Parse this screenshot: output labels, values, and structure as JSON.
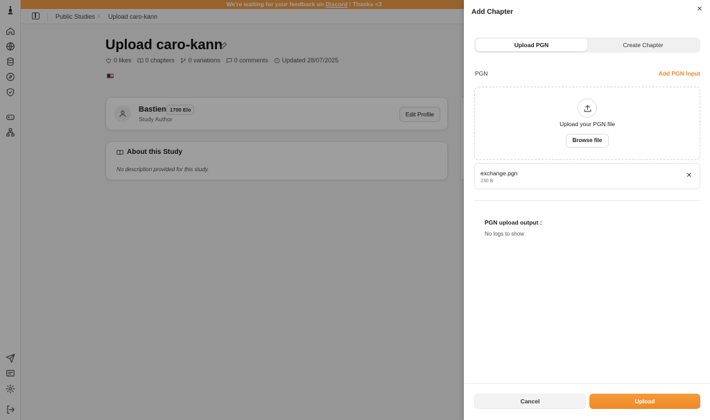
{
  "banner": {
    "pre": "We're waiting for your feedback on ",
    "link": "Discord",
    "post": " ! Thanks <3"
  },
  "breadcrumb": {
    "parent": "Public Studies",
    "current": "Upload caro-kann"
  },
  "study": {
    "title": "Upload caro-kann",
    "likes": "0 likes",
    "chapters": "0 chapters",
    "variations": "0 variations",
    "comments": "0 comments",
    "updated": "Updated 28/07/2025"
  },
  "author": {
    "name": "Bastien",
    "elo": "1700 Elo",
    "role": "Study Author",
    "edit_label": "Edit Profile"
  },
  "about": {
    "heading": "About this Study",
    "description": "No description provided for this study."
  },
  "drawer": {
    "title": "Add Chapter",
    "tabs": [
      {
        "label": "Upload PGN",
        "active": true
      },
      {
        "label": "Create Chapter",
        "active": false
      }
    ],
    "pgn_label": "PGN",
    "add_input_label": "Add PGN Input",
    "dropzone_text": "Upload your PGN file",
    "browse_label": "Browse file",
    "file": {
      "name": "exchange.pgn",
      "size": "230 B"
    },
    "output_title": "PGN upload output :",
    "output_empty": "No logs to show",
    "cancel_label": "Cancel",
    "upload_label": "Upload"
  },
  "colors": {
    "accent": "#f08a28",
    "banner": "#f5a04a"
  }
}
